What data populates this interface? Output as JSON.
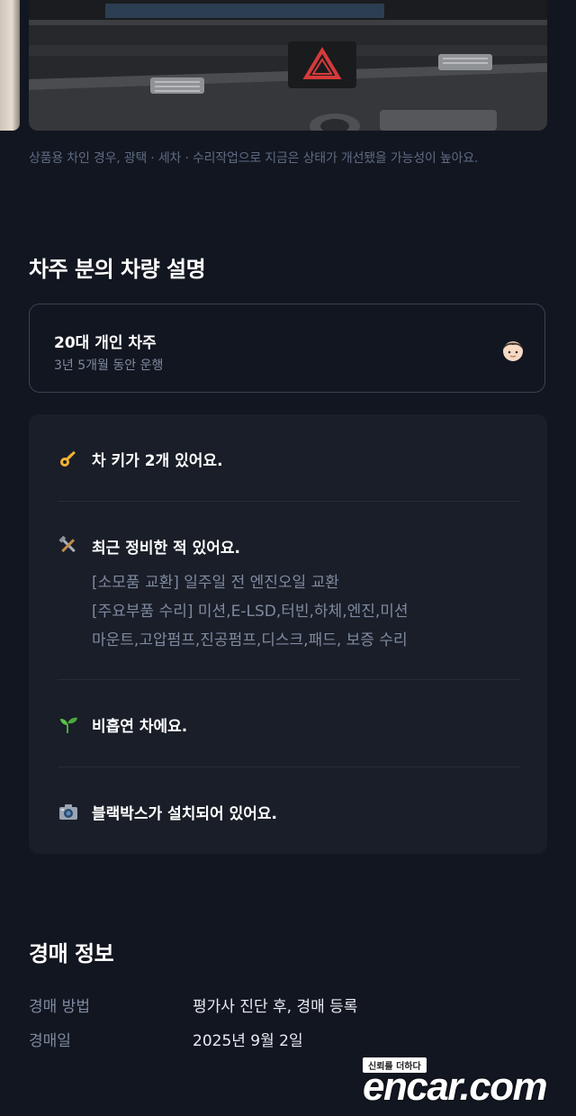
{
  "photo": {
    "caption": "상품용 차인 경우, 광택 · 세차 · 수리작업으로 지금은 상태가 개선됐을 가능성이 높아요."
  },
  "owner_section": {
    "title": "차주 분의 차량 설명",
    "owner": {
      "name": "20대 개인 차주",
      "duration": "3년 5개월 동안 운행",
      "avatar_icon": "person-avatar-icon"
    },
    "items": [
      {
        "icon": "key-icon",
        "text": "차 키가 2개 있어요.",
        "details": []
      },
      {
        "icon": "tools-icon",
        "text": "최근 정비한 적 있어요.",
        "details": [
          "[소모품 교환] 일주일 전 엔진오일 교환",
          "[주요부품 수리] 미션,E-LSD,터빈,하체,엔진,미션",
          "마운트,고압펌프,진공펌프,디스크,패드, 보증 수리"
        ]
      },
      {
        "icon": "seedling-icon",
        "text": "비흡연 차에요.",
        "details": []
      },
      {
        "icon": "camera-icon",
        "text": "블랙박스가 설치되어 있어요.",
        "details": []
      }
    ]
  },
  "auction_section": {
    "title": "경매 정보",
    "rows": [
      {
        "label": "경매 방법",
        "value": "평가사 진단 후, 경매 등록"
      },
      {
        "label": "경매일",
        "value": "2025년 9월 2일"
      }
    ]
  },
  "watermark": {
    "tagline": "신뢰를 더하다",
    "logo": "encar.com"
  },
  "colors": {
    "background": "#121620",
    "card_background": "#191e28",
    "muted_text": "#7f8aa0",
    "caption_text": "#5e6b82",
    "border": "#3b4252"
  }
}
